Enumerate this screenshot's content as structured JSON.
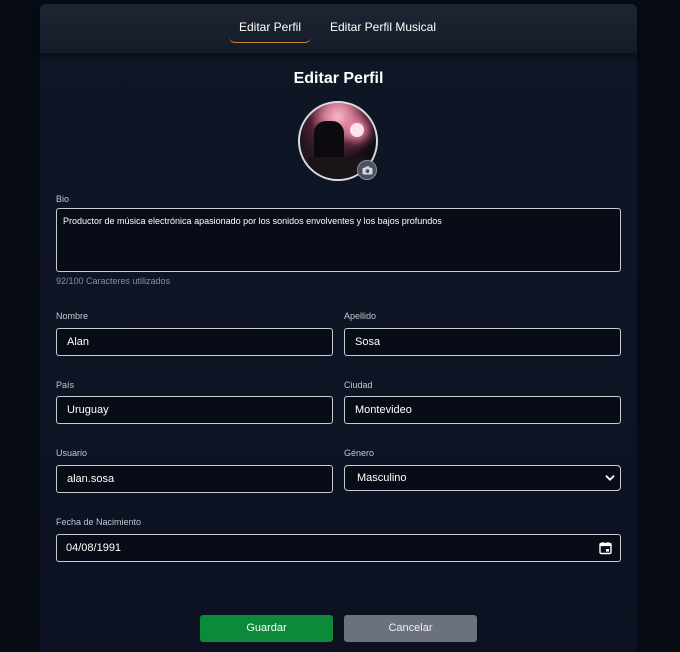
{
  "tabs": [
    {
      "label": "Editar Perfil",
      "active": true
    },
    {
      "label": "Editar Perfil Musical",
      "active": false
    }
  ],
  "page_title": "Editar Perfil",
  "avatar": {
    "camera_icon": "camera-icon"
  },
  "bio": {
    "label": "Bio",
    "value": "Productor de música electrónica apasionado por los sonidos envolventes y los bajos profundos",
    "counter": "92/100 Caracteres utilizados"
  },
  "form": {
    "nombre": {
      "label": "Nombre",
      "value": "Alan"
    },
    "apellido": {
      "label": "Apellido",
      "value": "Sosa"
    },
    "pais": {
      "label": "País",
      "value": "Uruguay"
    },
    "ciudad": {
      "label": "Ciudad",
      "value": "Montevideo"
    },
    "usuario": {
      "label": "Usuario",
      "value": "alan.sosa"
    },
    "genero": {
      "label": "Género",
      "value": "Masculino"
    },
    "fecha": {
      "label": "Fecha de Nacimiento",
      "value": "04/08/1991"
    }
  },
  "buttons": {
    "save": "Guardar",
    "cancel": "Cancelar"
  },
  "colors": {
    "accent": "#c9822f",
    "save": "#0b8a3a",
    "cancel": "#6c727d",
    "background": "#070b14"
  }
}
